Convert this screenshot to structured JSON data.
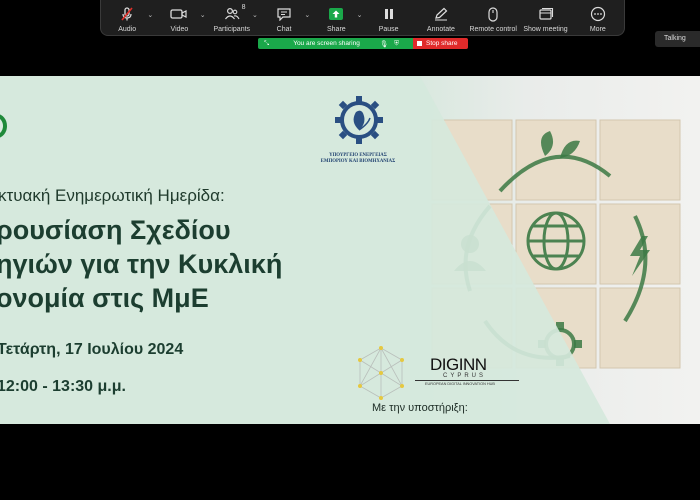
{
  "toolbar": {
    "audio_label": "Audio",
    "video_label": "Video",
    "participants_label": "Participants",
    "participants_count": "8",
    "chat_label": "Chat",
    "share_label": "Share",
    "pause_label": "Pause",
    "annotate_label": "Annotate",
    "remote_control_label": "Remote control",
    "show_meeting_label": "Show meeting",
    "more_label": "More"
  },
  "share_bar": {
    "status_text": "You are screen sharing",
    "stop_label": "Stop share"
  },
  "talking_label": "Talking",
  "slide": {
    "ministry_line1": "ΥΠΟΥΡΓΕΙΟ ΕΝΕΡΓΕΙΑΣ",
    "ministry_line2": "ΕΜΠΟΡΙΟΥ ΚΑΙ ΒΙΟΜΗΧΑΝΙΑΣ",
    "subtitle": "κτυακή Ενημερωτική Ημερίδα:",
    "title_line1": "ρουσίαση Σχεδίου",
    "title_line2": "ηγιών για την Κυκλική",
    "title_line3": "ονομία στις ΜμΕ",
    "date": "Τετάρτη, 17 Ιουλίου 2024",
    "time": "12:00 - 13:30 μ.μ.",
    "support_label": "Με την υποστήριξη:",
    "diginn_logo_text": "DIGINN",
    "diginn_sub": "CYPRUS",
    "diginn_tagline": "EUROPEAN DIGITAL INNOVATION HUB"
  },
  "colors": {
    "toolbar_bg": "#1f1f1f",
    "share_green": "#1aa84a",
    "stop_red": "#e02a2a",
    "mute_red": "#e0302a",
    "slide_green_text": "#1c3e30",
    "slide_bg": "#dcebe2"
  },
  "icons": [
    "microphone-muted-icon",
    "video-camera-icon",
    "participants-icon",
    "chat-icon",
    "share-arrow-icon",
    "pause-icon",
    "annotate-pencil-icon",
    "mouse-icon",
    "show-meeting-icon",
    "more-icon"
  ]
}
